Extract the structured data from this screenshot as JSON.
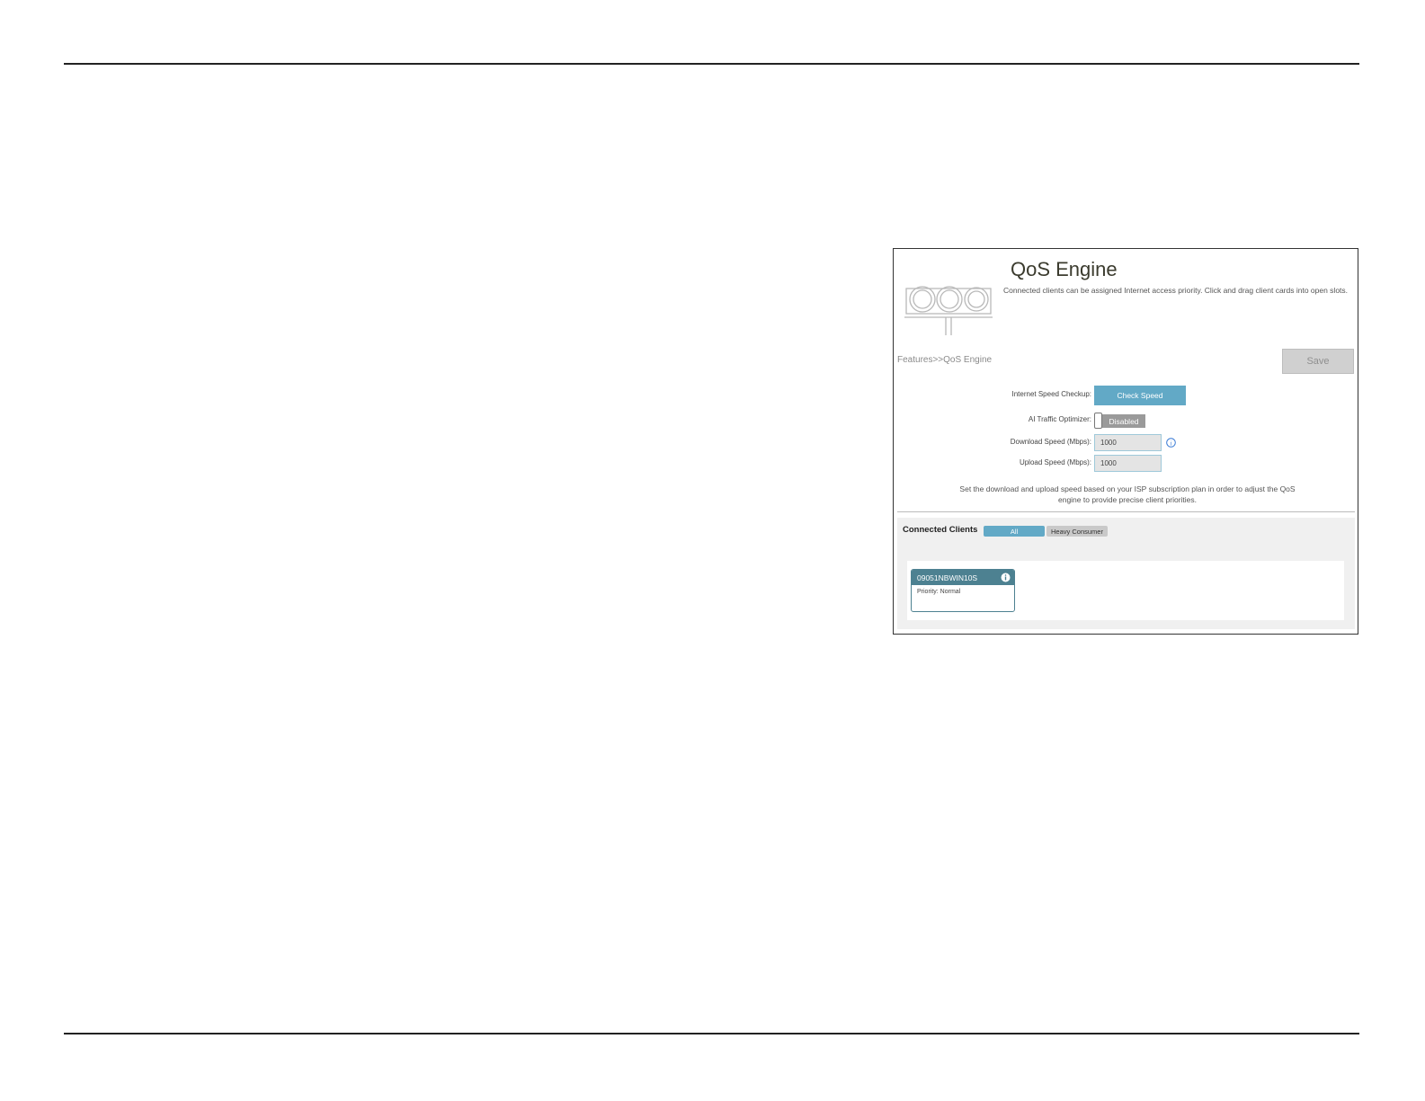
{
  "page": {
    "title": "QoS Engine",
    "subtitle": "Connected clients can be assigned Internet access priority. Click and drag client cards into open slots.",
    "breadcrumb": "Features>>QoS Engine",
    "save_label": "Save"
  },
  "settings": {
    "speed_checkup": {
      "label": "Internet Speed Checkup:",
      "button": "Check Speed"
    },
    "ai_optimizer": {
      "label": "AI Traffic Optimizer:",
      "state": "Disabled"
    },
    "download": {
      "label": "Download Speed (Mbps):",
      "value": "1000"
    },
    "upload": {
      "label": "Upload Speed (Mbps):",
      "value": "1000"
    },
    "note": "Set the download and upload speed based on your ISP subscription plan in order to adjust the QoS engine to provide precise client priorities."
  },
  "clients": {
    "title": "Connected Clients",
    "filters": [
      "All",
      "Heavy Consumer"
    ],
    "cards": [
      {
        "name": "09051NBWIN10S",
        "priority": "Priority: Normal"
      }
    ]
  },
  "colors": {
    "accent": "#62a9c6",
    "card_header": "#4d8191",
    "save_disabled": "#d0d0d0"
  }
}
